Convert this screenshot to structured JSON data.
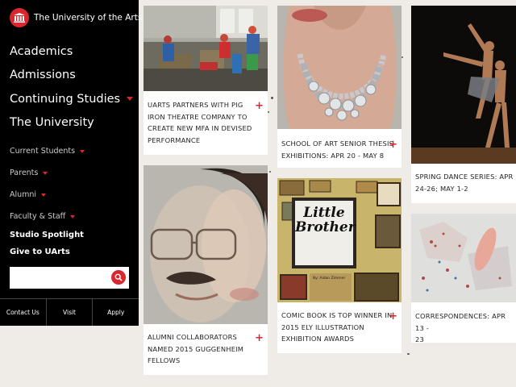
{
  "site": {
    "logo_text": "The University of the Arts"
  },
  "main_nav": [
    {
      "label": "Academics",
      "has_dropdown": false
    },
    {
      "label": "Admissions",
      "has_dropdown": false
    },
    {
      "label": "Continuing Studies",
      "has_dropdown": true
    },
    {
      "label": "The University",
      "has_dropdown": false
    }
  ],
  "sub_nav": [
    {
      "label": "Current Students",
      "has_dropdown": true
    },
    {
      "label": "Parents",
      "has_dropdown": true
    },
    {
      "label": "Alumni",
      "has_dropdown": true
    },
    {
      "label": "Faculty & Staff",
      "has_dropdown": true
    }
  ],
  "bold_nav": [
    "Studio Spotlight",
    "Give to UArts"
  ],
  "search": {
    "placeholder": "",
    "value": ""
  },
  "bottom_links": [
    "Contact Us",
    "Visit",
    "Apply"
  ],
  "cards": [
    {
      "id": "pig-iron",
      "lines": [
        "UARTS PARTNERS WITH PIG",
        "IRON THEATRE COMPANY TO",
        "CREATE NEW MFA IN DEVISED",
        "PERFORMANCE"
      ]
    },
    {
      "id": "guggenheim",
      "lines": [
        "ALUMNI COLLABORATORS",
        "NAMED 2015 GUGGENHEIM",
        "FELLOWS"
      ]
    },
    {
      "id": "senior-thesis",
      "lines": [
        "SCHOOL OF ART SENIOR THESIS",
        "EXHIBITIONS: APR 20 - MAY 8"
      ]
    },
    {
      "id": "comic-book",
      "lines": [
        "COMIC BOOK IS TOP WINNER IN",
        "2015 ELY ILLUSTRATION",
        "EXHIBITION AWARDS"
      ]
    },
    {
      "id": "dance",
      "lines": [
        "SPRING DANCE SERIES: APR",
        "24-26; MAY 1-2"
      ]
    },
    {
      "id": "correspondences",
      "lines": [
        "CORRESPONDENCES: APR 13 -",
        "23"
      ]
    }
  ],
  "comic_cover": {
    "title_line1": "Little",
    "title_line2": "Brother",
    "author": "By: Aidan Zimmer"
  },
  "colors": {
    "accent": "#d8272e",
    "sidebar_bg": "#000000",
    "page_bg": "#efebe7"
  }
}
